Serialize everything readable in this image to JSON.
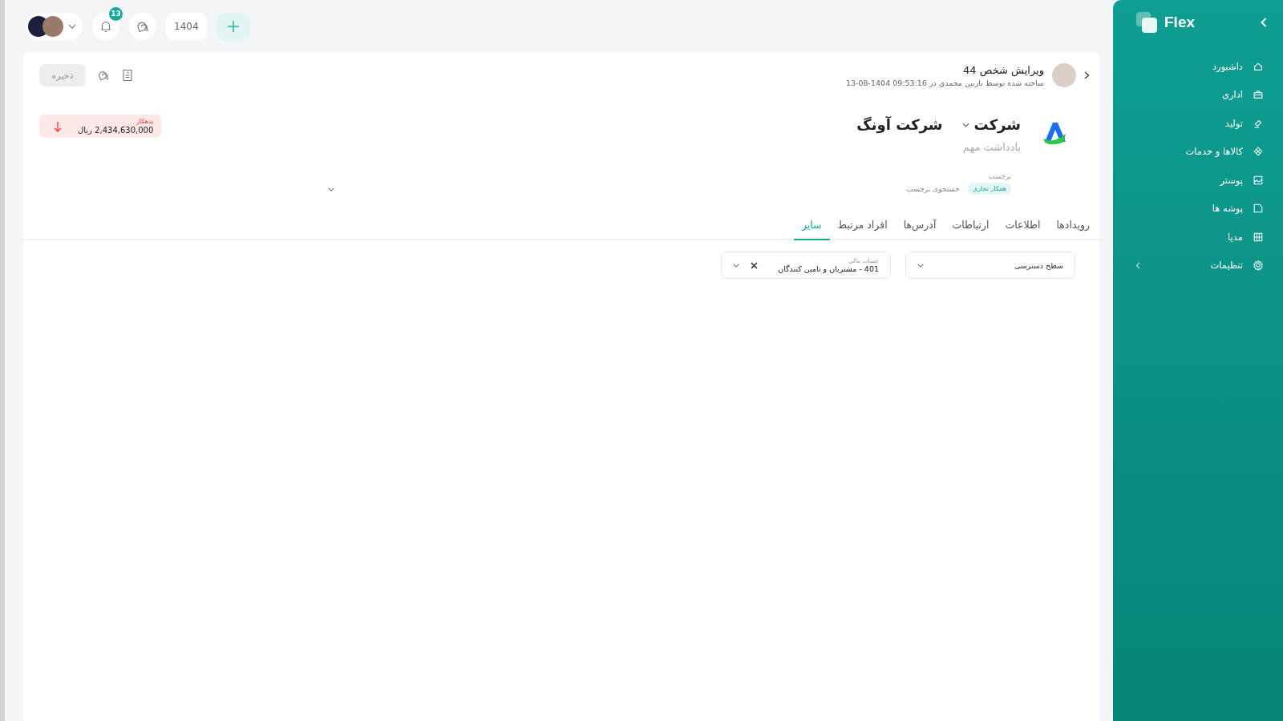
{
  "top_bar": {
    "notifications": {
      "count": "13"
    },
    "year": "1404"
  },
  "header": {
    "title": "ویرایش شخص 44",
    "subtitle": "ساخته شده توسط نازنین محمدی در 09:53:16 1404-08-13",
    "save_button": {
      "label": "ذخیره",
      "disabled": true
    }
  },
  "entity": {
    "type": "شرکت",
    "name": "شرکت آونگ",
    "note_placeholder": "یادداشت مهم"
  },
  "balance": {
    "label": "بدهکار",
    "amount": "2,434,630,000 ریال"
  },
  "tags": {
    "label": "برچسب",
    "items": [
      {
        "label": "همکار تجاری"
      }
    ],
    "placeholder": "جستجوی برچسب"
  },
  "tabs": [
    {
      "label": "رویدادها",
      "selected": false
    },
    {
      "label": "اطلاعات",
      "selected": false
    },
    {
      "label": "ارتباطات",
      "selected": false
    },
    {
      "label": "آدرس‌ها",
      "selected": false
    },
    {
      "label": "افراد مرتبط",
      "selected": false
    },
    {
      "label": "سایر",
      "selected": true
    }
  ],
  "fields": [
    {
      "placeholder": "سطح دسترسی",
      "clearable": false
    },
    {
      "label": "حساب مالی",
      "value": "401 - مشتریان و تامین کنندگان",
      "clearable": true
    }
  ],
  "sidebar": {
    "brand": "Flex",
    "items": [
      {
        "label": "داشبورد",
        "has_submenu": false
      },
      {
        "label": "اداری",
        "has_submenu": false
      },
      {
        "label": "تولید",
        "has_submenu": false
      },
      {
        "label": "کالاها و خدمات",
        "has_submenu": false
      },
      {
        "label": "پوستر",
        "has_submenu": false
      },
      {
        "label": "پوشه ها",
        "has_submenu": false
      },
      {
        "label": "مدیا",
        "has_submenu": false
      },
      {
        "label": "تنظیمات",
        "has_submenu": true
      }
    ]
  }
}
